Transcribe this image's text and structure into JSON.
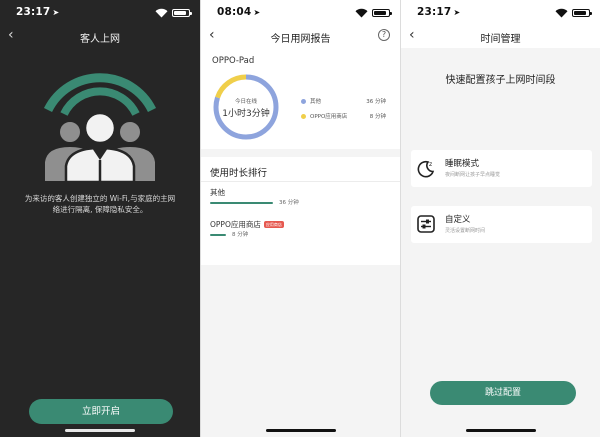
{
  "colors": {
    "accent": "#3a8a73",
    "dark_bg": "#262626",
    "light_bg": "#f4f4f4",
    "ring_blue": "#8ea4dd",
    "ring_yellow": "#f0cf4a",
    "badge_red": "#e6584f"
  },
  "guest": {
    "status_time": "23:17",
    "title": "客人上网",
    "description": "为来访的客人创建独立的 Wi-Fi,与家庭的主网络进行隔离, 保障隐私安全。",
    "button": "立即开启",
    "illustration_icon": "guests-wifi-icon"
  },
  "report": {
    "status_time": "08:04",
    "title": "今日用网报告",
    "help": "?",
    "device": "OPPO-Pad",
    "ring_label": "今日在线",
    "ring_value": "1小时3分钟",
    "legend": [
      {
        "name": "其他",
        "value": "36 分钟",
        "color": "#8ea4dd",
        "fraction": 0.8
      },
      {
        "name": "OPPO应用商店",
        "value": "8 分钟",
        "color": "#f0cf4a",
        "fraction": 0.2
      }
    ],
    "ranking_title": "使用时长排行",
    "apps": [
      {
        "name": "其他",
        "badge": "",
        "duration": "36 分钟",
        "fraction": 0.35
      },
      {
        "name": "OPPO应用商店",
        "badge": "应用商店",
        "duration": "8 分钟",
        "fraction": 0.09
      }
    ]
  },
  "time_mgmt": {
    "status_time": "23:17",
    "title": "时间管理",
    "headline": "快速配置孩子上网时间段",
    "options": [
      {
        "title": "睡眠模式",
        "subtitle": "夜间断网让孩子早点睡觉",
        "icon": "sleep-mode-icon"
      },
      {
        "title": "自定义",
        "subtitle": "灵活设置断网时间",
        "icon": "custom-settings-icon"
      }
    ],
    "skip_button": "跳过配置"
  },
  "status_icons": {
    "wifi": "wifi-icon",
    "battery": "battery-icon",
    "location": "location-arrow-icon",
    "battery_level": 0.85
  }
}
